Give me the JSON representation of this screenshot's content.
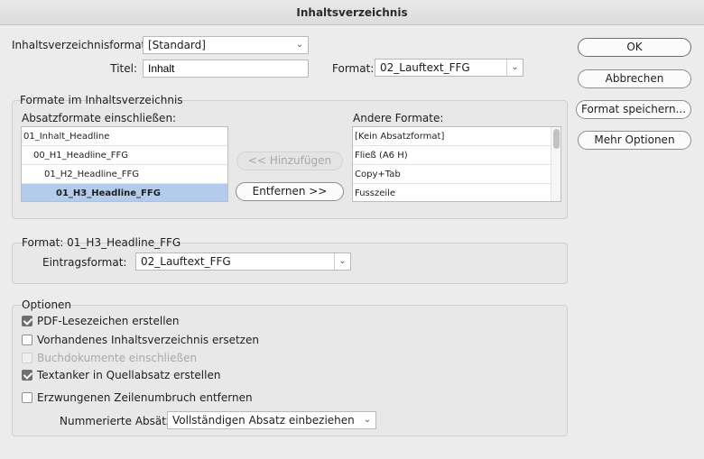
{
  "window": {
    "title": "Inhaltsverzeichnis"
  },
  "top": {
    "toc_format_label": "Inhaltsverzeichnisformat:",
    "toc_format_value": "[Standard]",
    "title_label": "Titel:",
    "title_value": "Inhalt",
    "format_label": "Format:",
    "format_value": "02_Lauftext_FFG"
  },
  "styles_group": {
    "title": "Formate im Inhaltsverzeichnis",
    "include_label": "Absatzformate einschließen:",
    "included": [
      {
        "label": "01_Inhalt_Headline",
        "selected": false
      },
      {
        "label": "00_H1_Headline_FFG",
        "selected": false
      },
      {
        "label": "01_H2_Headline_FFG",
        "selected": false
      },
      {
        "label": "01_H3_Headline_FFG",
        "selected": true
      }
    ],
    "add_button": "<< Hinzufügen",
    "remove_button": "Entfernen >>",
    "other_label": "Andere Formate:",
    "other": [
      "[Kein Absatzformat]",
      "Fließ (A6 H)",
      "Copy+Tab",
      "Fusszeile"
    ]
  },
  "style_group": {
    "title": "Format: 01_H3_Headline_FFG",
    "entry_label": "Eintragsformat:",
    "entry_value": "02_Lauftext_FFG"
  },
  "options_group": {
    "title": "Optionen",
    "checkboxes": [
      {
        "label": "PDF-Lesezeichen erstellen",
        "checked": true,
        "disabled": false
      },
      {
        "label": "Vorhandenes Inhaltsverzeichnis ersetzen",
        "checked": false,
        "disabled": false
      },
      {
        "label": "Buchdokumente einschließen",
        "checked": false,
        "disabled": true
      },
      {
        "label": "Textanker in Quellabsatz erstellen",
        "checked": true,
        "disabled": false
      },
      {
        "label": "Erzwungenen Zeilenumbruch entfernen",
        "checked": false,
        "disabled": false
      }
    ],
    "numbered_label": "Nummerierte Absätze:",
    "numbered_value": "Vollständigen Absatz einbeziehen"
  },
  "side_buttons": {
    "ok": "OK",
    "cancel": "Abbrechen",
    "save": "Format speichern...",
    "more": "Mehr Optionen"
  },
  "icons": {
    "dropdown": "chevron-down-icon",
    "check": "checkmark-icon"
  },
  "colors": {
    "selection": "#b4ccec",
    "background": "#ececec"
  }
}
